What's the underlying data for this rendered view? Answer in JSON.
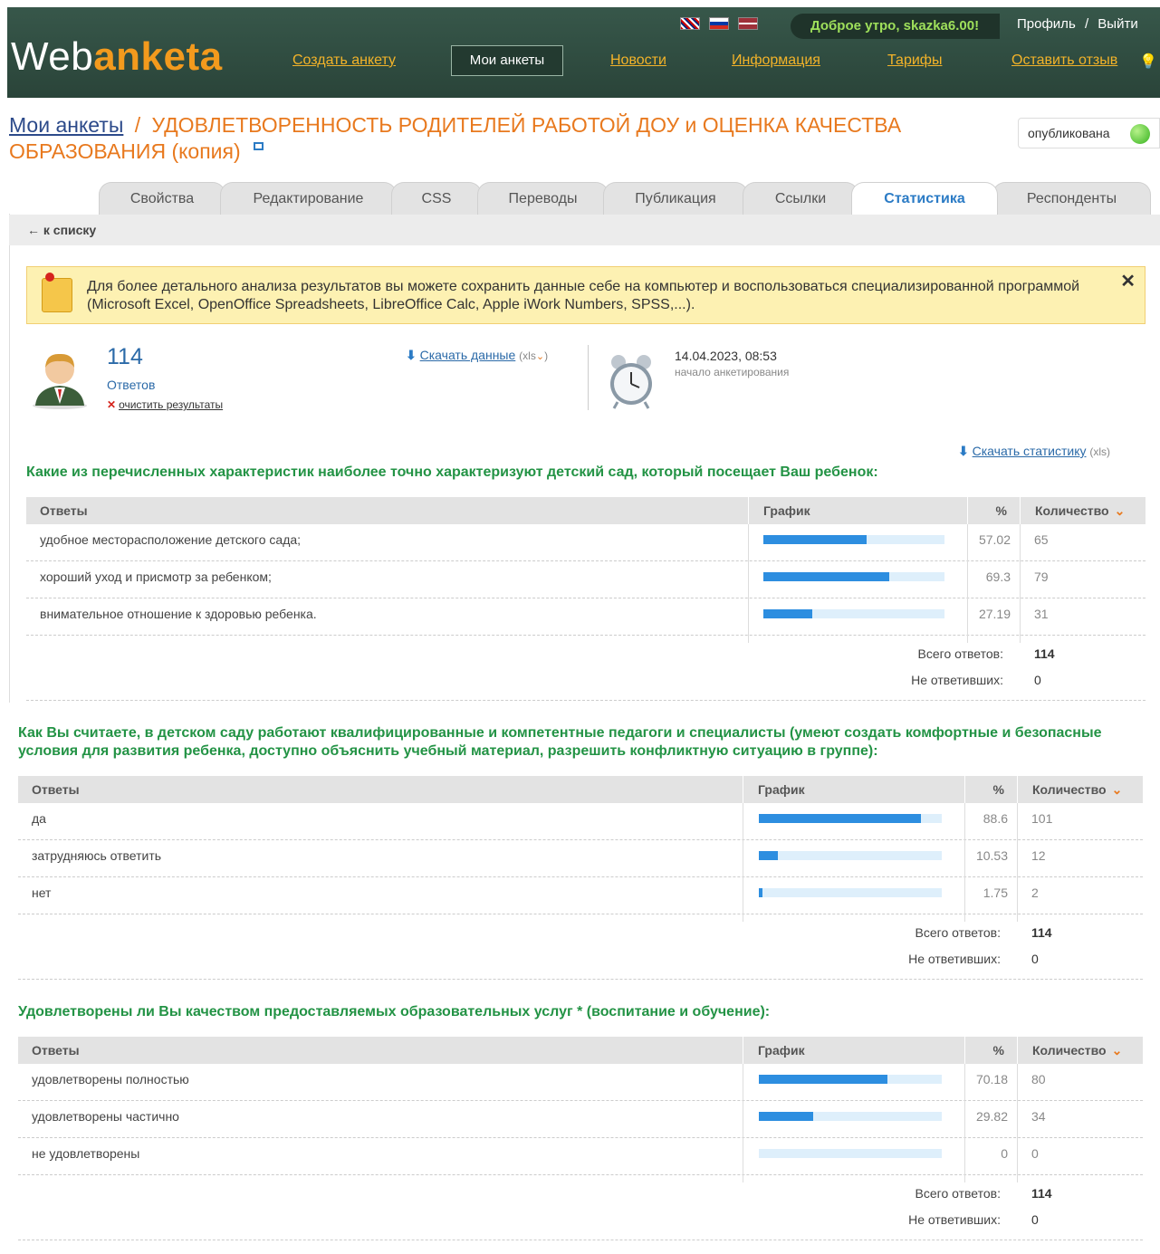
{
  "header": {
    "logo_web": "Web",
    "logo_anketa": "anketa",
    "greeting": "Доброе утро, skazka6.00!",
    "profile": "Профиль",
    "sep": "/",
    "logout": "Выйти",
    "nav": {
      "create": "Создать анкету",
      "my": "Мои анкеты",
      "news": "Новости",
      "info": "Информация",
      "tariffs": "Тарифы",
      "feedback": "Оставить отзыв"
    }
  },
  "breadcrumb": {
    "root": "Мои анкеты",
    "sep": "/",
    "title": "УДОВЛЕТВОРЕННОСТЬ РОДИТЕЛЕЙ РАБОТОЙ ДОУ и ОЦЕНКА КАЧЕСТВА ОБРАЗОВАНИЯ (копия)"
  },
  "status": "опубликована",
  "tabs": [
    "Свойства",
    "Редактирование",
    "CSS",
    "Переводы",
    "Публикация",
    "Ссылки",
    "Статистика",
    "Респонденты"
  ],
  "back": "← к списку",
  "notice": "Для более детального анализа результатов вы можете сохранить данные себе на компьютер и воспользоваться специализированной программой (Microsoft Excel, OpenOffice Spreadsheets, LibreOffice Calc, Apple iWork Numbers, SPSS,...).",
  "summary": {
    "count": "114",
    "count_label": "Ответов",
    "clear": "очистить результаты",
    "download": "Скачать данные",
    "download_fmt": "(xls",
    "download_fmt_end": ")",
    "date": "14.04.2023, 08:53",
    "date_label": "начало анкетирования",
    "download_stats": "Скачать статистику",
    "download_stats_fmt": "(xls)"
  },
  "table_headers": {
    "answers": "Ответы",
    "chart": "График",
    "percent": "%",
    "count": "Количество"
  },
  "totals_labels": {
    "total": "Всего ответов:",
    "none": "Не ответивших:"
  },
  "questions": [
    {
      "text": "Какие из перечисленных характеристик наиболее точно характеризуют детский сад, который посещает Ваш ребенок:",
      "rows": [
        {
          "answer": "удобное месторасположение детского сада;",
          "percent": "57.02",
          "count": "65",
          "fraction": 0.5702
        },
        {
          "answer": "хороший уход и присмотр за ребенком;",
          "percent": "69.3",
          "count": "79",
          "fraction": 0.693
        },
        {
          "answer": "внимательное отношение к здоровью ребенка.",
          "percent": "27.19",
          "count": "31",
          "fraction": 0.2719
        }
      ],
      "total": "114",
      "none": "0"
    },
    {
      "text": "Как Вы считаете, в детском саду работают квалифицированные и компетентные педагоги и специалисты (умеют создать комфортные и безопасные условия для развития ребенка, доступно объяснить учебный материал, разрешить конфликтную ситуацию в группе):",
      "rows": [
        {
          "answer": "да",
          "percent": "88.6",
          "count": "101",
          "fraction": 0.886
        },
        {
          "answer": "затрудняюсь ответить",
          "percent": "10.53",
          "count": "12",
          "fraction": 0.1053
        },
        {
          "answer": "нет",
          "percent": "1.75",
          "count": "2",
          "fraction": 0.0175
        }
      ],
      "total": "114",
      "none": "0"
    },
    {
      "text": "Удовлетворены ли Вы качеством предоставляемых образовательных услуг * (воспитание и обучение):",
      "rows": [
        {
          "answer": "удовлетворены полностью",
          "percent": "70.18",
          "count": "80",
          "fraction": 0.7018
        },
        {
          "answer": "удовлетворены частично",
          "percent": "29.82",
          "count": "34",
          "fraction": 0.2982
        },
        {
          "answer": "не удовлетворены",
          "percent": "0",
          "count": "0",
          "fraction": 0
        }
      ],
      "total": "114",
      "none": "0"
    }
  ],
  "colors": {
    "header_bg": "#2e4b3f",
    "accent_orange": "#e8791e",
    "question_green": "#239345",
    "bar_blue": "#2d8ee0",
    "bar_bg": "#deeffb",
    "link_blue": "#2b6aa8"
  }
}
